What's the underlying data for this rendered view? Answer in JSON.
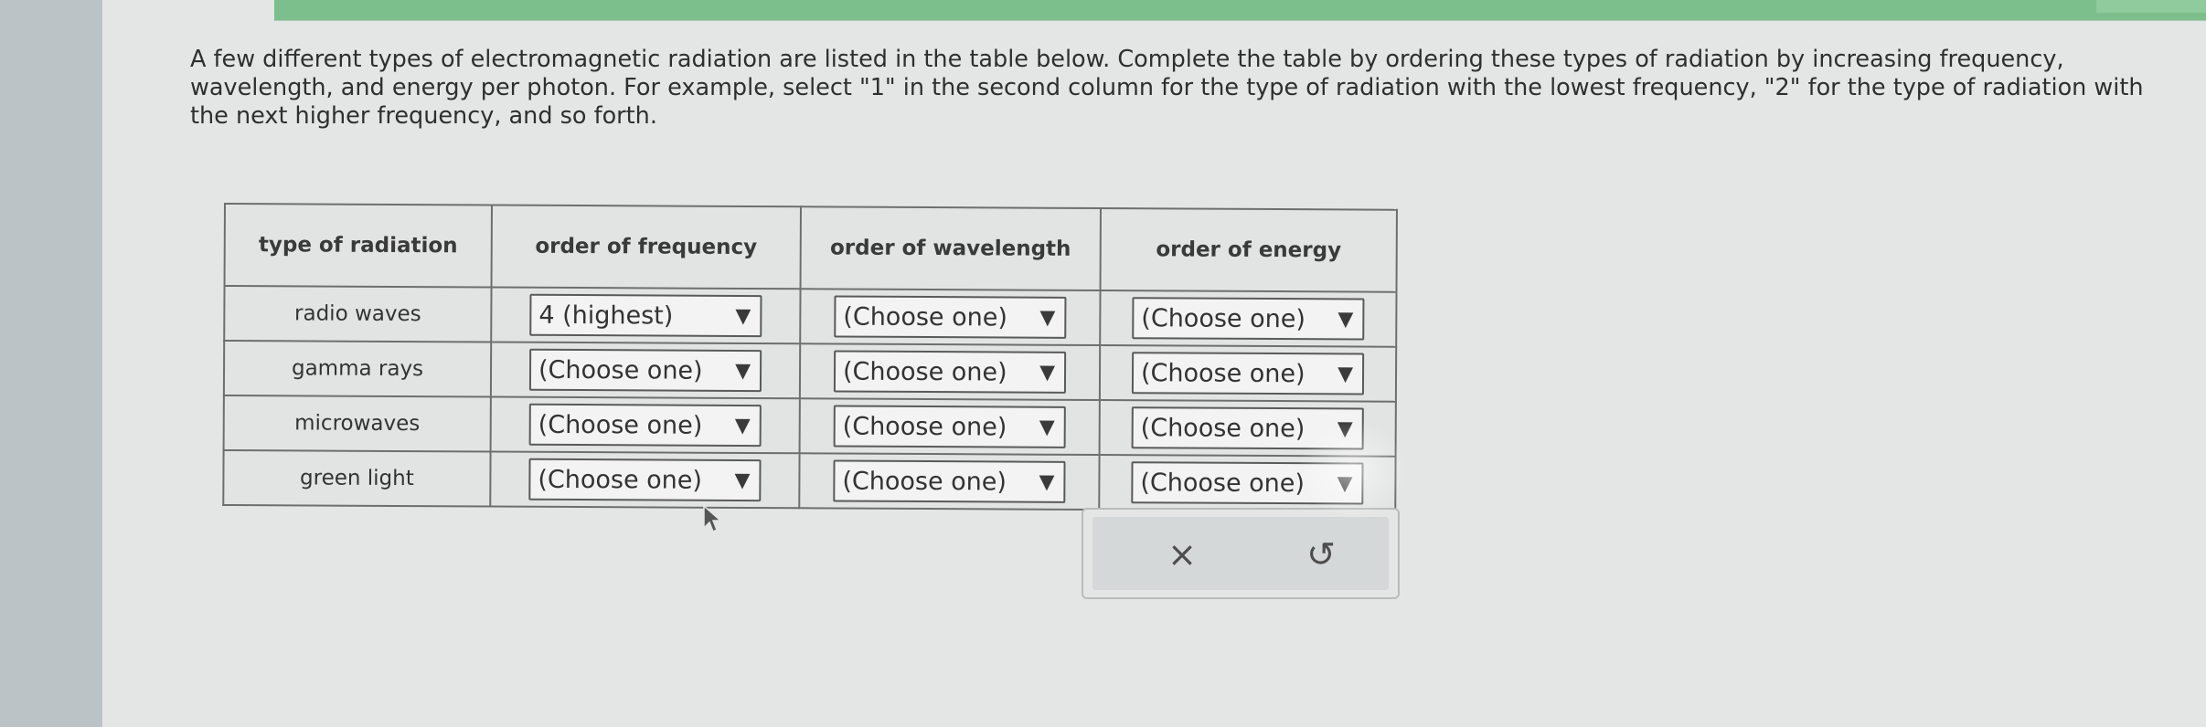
{
  "prompt": "A few different types of electromagnetic radiation are listed in the table below. Complete the table by ordering these types of radiation by increasing frequency, wavelength, and energy per photon. For example, select \"1\" in the second column for the type of radiation with the lowest frequency, \"2\" for the type of radiation with the next higher frequency, and so forth.",
  "table": {
    "headers": [
      "type of radiation",
      "order of frequency",
      "order of wavelength",
      "order of energy"
    ],
    "rows": [
      {
        "type": "radio waves",
        "frequency": "4 (highest)",
        "wavelength": "(Choose one)",
        "energy": "(Choose one)"
      },
      {
        "type": "gamma rays",
        "frequency": "(Choose one)",
        "wavelength": "(Choose one)",
        "energy": "(Choose one)"
      },
      {
        "type": "microwaves",
        "frequency": "(Choose one)",
        "wavelength": "(Choose one)",
        "energy": "(Choose one)"
      },
      {
        "type": "green light",
        "frequency": "(Choose one)",
        "wavelength": "(Choose one)",
        "energy": "(Choose one)"
      }
    ]
  },
  "icons": {
    "dropdown_arrow": "▼",
    "clear": "×",
    "undo": "↺"
  },
  "colors": {
    "header_strip": "#7cbf8c",
    "page_bg": "#e4e6e5",
    "text": "#2f2f2f"
  }
}
